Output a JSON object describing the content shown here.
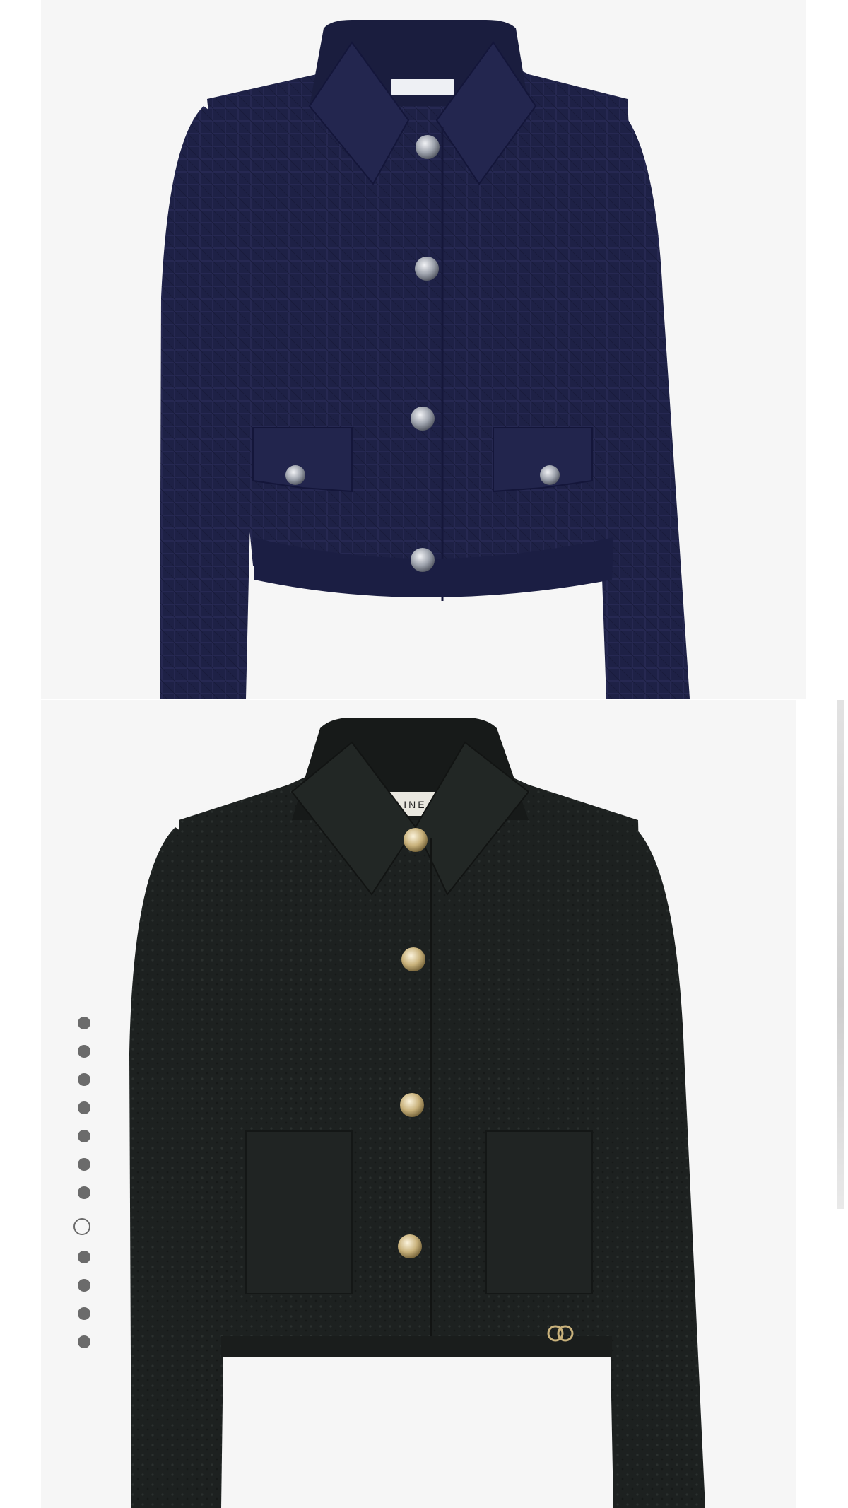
{
  "gallery": {
    "images": [
      {
        "subject": "navy-tweed-jacket",
        "label_text": ""
      },
      {
        "subject": "black-tweed-jacket",
        "label_text": "LINE"
      }
    ],
    "carousel": {
      "total": 12,
      "active_index": 7
    }
  },
  "colors": {
    "background": "#ffffff",
    "panel": "#f6f6f6",
    "navy_jacket": "#1e2146",
    "black_jacket": "#1d2120",
    "silver_button": "#c9ccd3",
    "gold_button": "#d9c9a0",
    "dot": "#6b6b6b"
  }
}
